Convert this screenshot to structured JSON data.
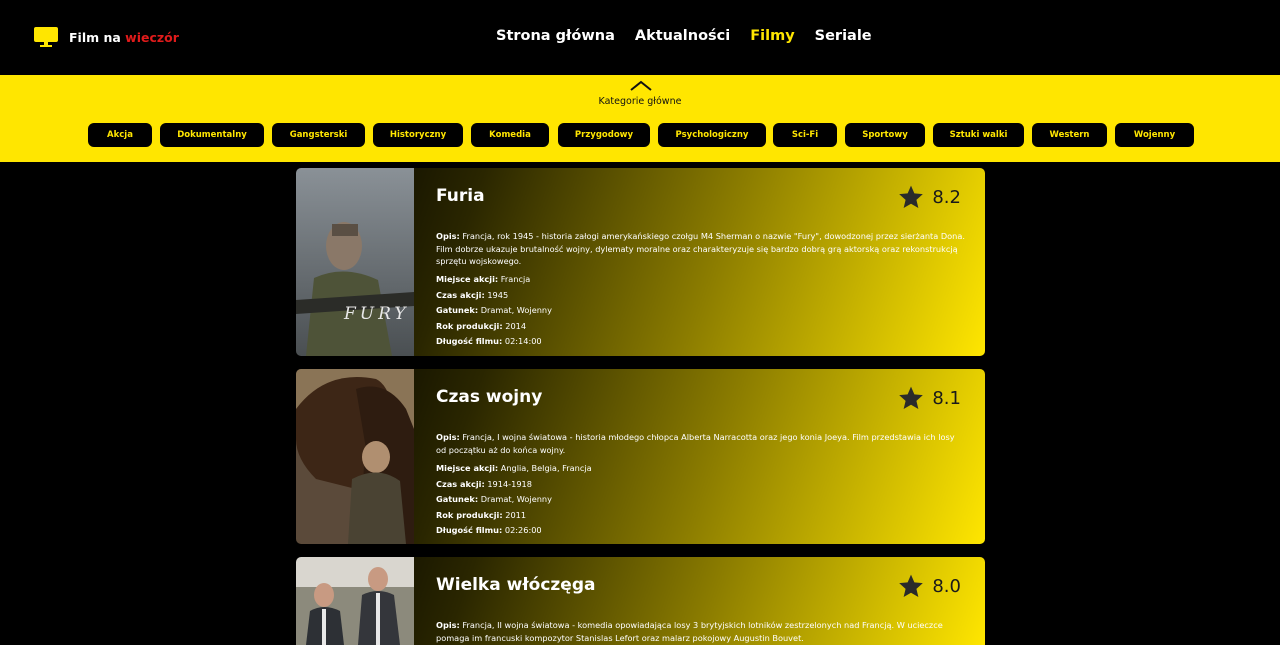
{
  "header": {
    "logo_main": "Film na ",
    "logo_accent": "wieczór",
    "nav": [
      {
        "label": "Strona główna",
        "active": false
      },
      {
        "label": "Aktualności",
        "active": false
      },
      {
        "label": "Filmy",
        "active": true
      },
      {
        "label": "Seriale",
        "active": false
      }
    ]
  },
  "categories": {
    "title": "Kategorie główne",
    "items": [
      "Akcja",
      "Dokumentalny",
      "Gangsterski",
      "Historyczny",
      "Komedia",
      "Przygodowy",
      "Psychologiczny",
      "Sci-Fi",
      "Sportowy",
      "Sztuki walki",
      "Western",
      "Wojenny"
    ]
  },
  "labels": {
    "desc": "Opis:",
    "place": "Miejsce akcji:",
    "time": "Czas akcji:",
    "genre": "Gatunek:",
    "year": "Rok produkcji:",
    "length": "Długość filmu:"
  },
  "films": [
    {
      "title": "Furia",
      "rating": "8.2",
      "desc": "Francja, rok 1945 - historia załogi amerykańskiego czołgu M4 Sherman o nazwie \"Fury\", dowodzonej przez sierżanta Dona. Film dobrze ukazuje brutalność wojny, dylematy moralne oraz charakteryzuje się bardzo dobrą grą aktorską oraz rekonstrukcją sprzętu wojskowego.",
      "place": "Francja",
      "time": "1945",
      "genre": "Dramat, Wojenny",
      "year": "2014",
      "length": "02:14:00",
      "poster_text": "FURY"
    },
    {
      "title": "Czas wojny",
      "rating": "8.1",
      "desc": "Francja, I wojna światowa - historia młodego chłopca Alberta Narracotta oraz jego konia Joeya. Film przedstawia ich losy od początku aż do końca wojny.",
      "place": "Anglia, Belgia, Francja",
      "time": "1914-1918",
      "genre": "Dramat, Wojenny",
      "year": "2011",
      "length": "02:26:00"
    },
    {
      "title": "Wielka włóczęga",
      "rating": "8.0",
      "desc": "Francja, II wojna światowa - komedia opowiadająca losy 3 brytyjskich lotników zestrzelonych nad Francją. W ucieczce pomaga im francuski kompozytor Stanislas Lefort oraz malarz pokojowy Augustin Bouvet."
    }
  ],
  "colors": {
    "accent": "#ffe600",
    "logo_accent": "#e01b1b",
    "background": "#000000"
  }
}
